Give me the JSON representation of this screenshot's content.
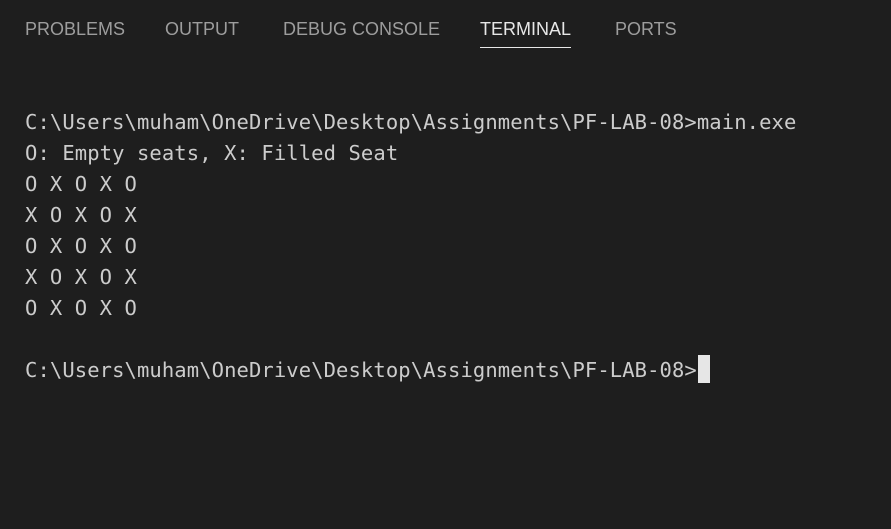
{
  "panel": {
    "tabs": [
      {
        "label": "PROBLEMS"
      },
      {
        "label": "OUTPUT"
      },
      {
        "label": "DEBUG CONSOLE"
      },
      {
        "label": "TERMINAL"
      },
      {
        "label": "PORTS"
      }
    ],
    "active_tab": "TERMINAL"
  },
  "terminal": {
    "command_line": "C:\\Users\\muham\\OneDrive\\Desktop\\Assignments\\PF-LAB-08>main.exe",
    "output": [
      "O: Empty seats, X: Filled Seat",
      "O X O X O",
      "X O X O X",
      "O X O X O",
      "X O X O X",
      "O X O X O"
    ],
    "prompt": "C:\\Users\\muham\\OneDrive\\Desktop\\Assignments\\PF-LAB-08>"
  },
  "colors": {
    "background": "#1e1e1e",
    "tab_inactive": "#9d9d9d",
    "tab_active": "#e7e7e7",
    "terminal_text": "#cccccc",
    "cursor": "#e6e6e6"
  }
}
